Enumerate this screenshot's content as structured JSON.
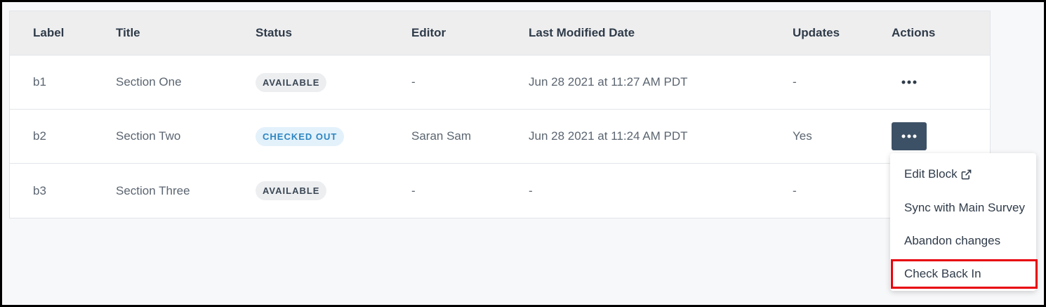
{
  "columns": {
    "label": "Label",
    "title": "Title",
    "status": "Status",
    "editor": "Editor",
    "last_modified": "Last Modified Date",
    "updates": "Updates",
    "actions": "Actions"
  },
  "rows": [
    {
      "label": "b1",
      "title": "Section One",
      "status": "AVAILABLE",
      "editor": "-",
      "last_modified": "Jun 28 2021 at 11:27 AM PDT",
      "updates": "-"
    },
    {
      "label": "b2",
      "title": "Section Two",
      "status": "CHECKED OUT",
      "editor": "Saran Sam",
      "last_modified": "Jun 28 2021 at 11:24 AM PDT",
      "updates": "Yes"
    },
    {
      "label": "b3",
      "title": "Section Three",
      "status": "AVAILABLE",
      "editor": "-",
      "last_modified": "-",
      "updates": "-"
    }
  ],
  "menu": {
    "edit_block": "Edit Block",
    "sync": "Sync with Main Survey",
    "abandon": "Abandon changes",
    "check_in": "Check Back In"
  },
  "colors": {
    "accent_button": "#3d5166",
    "available_badge_bg": "#eceef0",
    "checked_out_badge_bg": "#e3f1fb",
    "checked_out_text": "#2e86c1",
    "highlight": "#e8000b"
  },
  "icons": {
    "more": "more-horizontal-icon",
    "external_link": "external-link-icon"
  }
}
